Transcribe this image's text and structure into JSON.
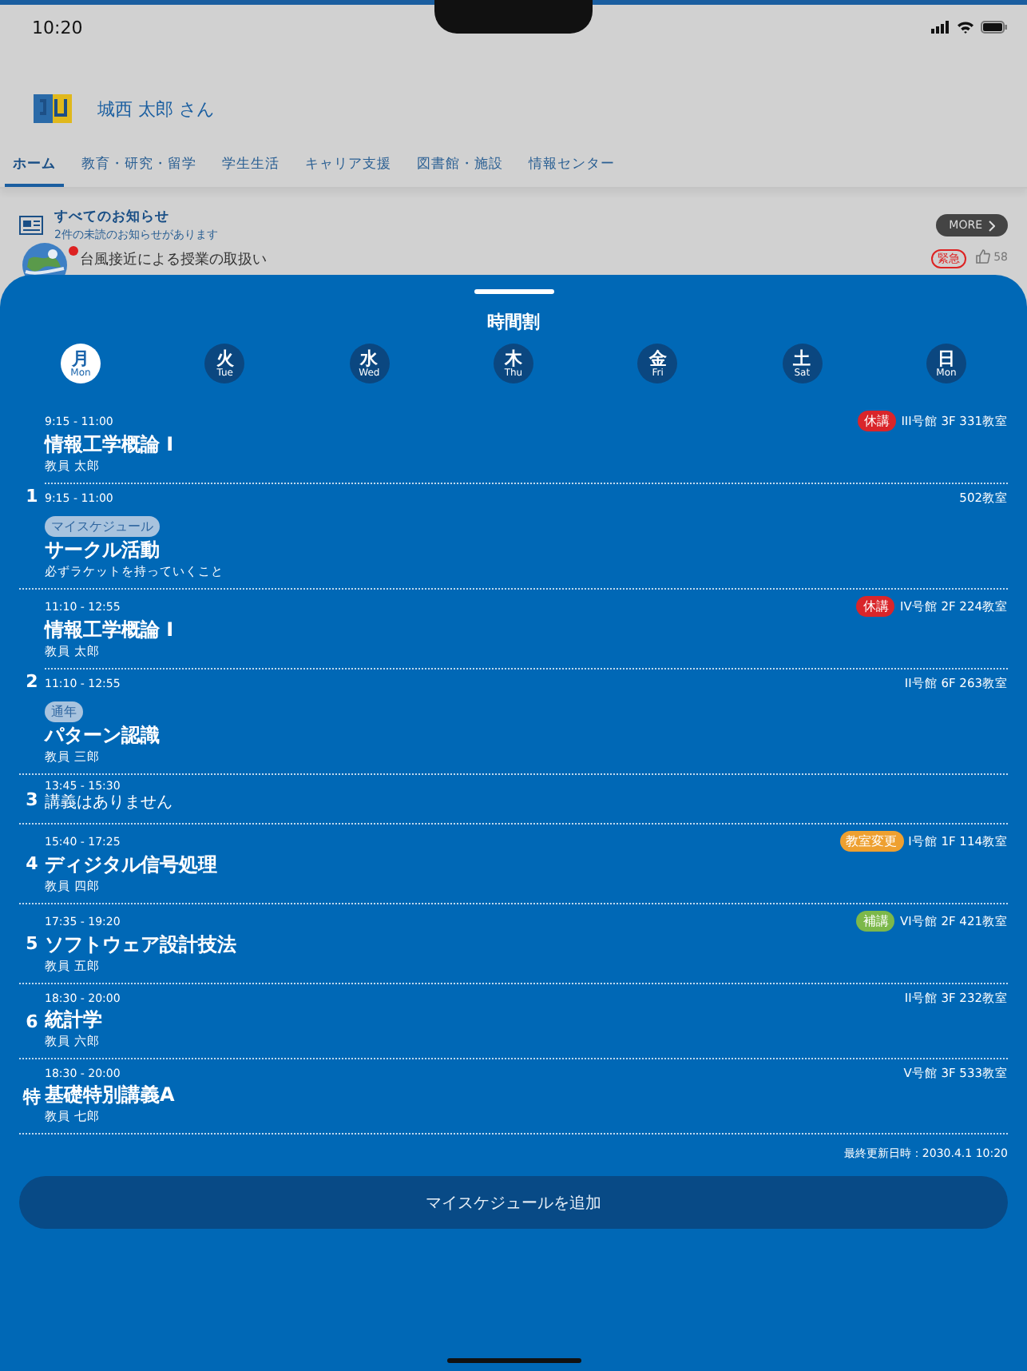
{
  "status_bar": {
    "time": "10:20"
  },
  "header": {
    "user_name": "城西 太郎 さん"
  },
  "nav_tabs": [
    {
      "label": "ホーム",
      "selected": true
    },
    {
      "label": "教育・研究・留学",
      "selected": false
    },
    {
      "label": "学生生活",
      "selected": false
    },
    {
      "label": "キャリア支援",
      "selected": false
    },
    {
      "label": "図書館・施設",
      "selected": false
    },
    {
      "label": "情報センター",
      "selected": false
    }
  ],
  "notices": {
    "title": "すべてのお知らせ",
    "subtitle": "2件の未読のお知らせがあります",
    "more_button": "MORE",
    "items": [
      {
        "title": "台風接近による授業の取扱い",
        "unread": true,
        "tag": "緊急",
        "likes": "58"
      }
    ]
  },
  "timetable": {
    "title": "時間割",
    "days": [
      {
        "label": "月",
        "sub": "Mon",
        "selected": true
      },
      {
        "label": "火",
        "sub": "Tue",
        "selected": false
      },
      {
        "label": "水",
        "sub": "Wed",
        "selected": false
      },
      {
        "label": "木",
        "sub": "Thu",
        "selected": false
      },
      {
        "label": "金",
        "sub": "Fri",
        "selected": false
      },
      {
        "label": "土",
        "sub": "Sat",
        "selected": false
      },
      {
        "label": "日",
        "sub": "Mon",
        "selected": false
      }
    ],
    "periods": [
      {
        "label": "1",
        "classes": [
          {
            "time": "9:15 - 11:00",
            "tag": {
              "text": "休講",
              "kind": "cancelled"
            },
            "room": "III号館 3F 331教室",
            "title": "情報工学概論 I",
            "subtitle": "教員 太郎"
          },
          {
            "time": "9:15 - 11:00",
            "tag": {
              "text": "マイスケジュール",
              "kind": "label"
            },
            "room": "502教室",
            "title": "サークル活動",
            "subtitle": "必ずラケットを持っていくこと"
          }
        ]
      },
      {
        "label": "2",
        "classes": [
          {
            "time": "11:10 - 12:55",
            "tag": {
              "text": "休講",
              "kind": "cancelled"
            },
            "room": "IV号館 2F 224教室",
            "title": "情報工学概論 I",
            "subtitle": "教員 太郎"
          },
          {
            "time": "11:10 - 12:55",
            "tag": {
              "text": "通年",
              "kind": "label"
            },
            "room": "II号館 6F 263教室",
            "title": "パターン認識",
            "subtitle": "教員 三郎"
          }
        ]
      },
      {
        "label": "3",
        "classes": [
          {
            "time": "13:45 - 15:30",
            "title": "講義はありません",
            "kind": "empty"
          }
        ]
      },
      {
        "label": "4",
        "classes": [
          {
            "time": "15:40 - 17:25",
            "tag": {
              "text": "教室変更",
              "kind": "room_change"
            },
            "room": "I号館 1F 114教室",
            "title": "ディジタル信号処理",
            "subtitle": "教員 四郎"
          }
        ]
      },
      {
        "label": "5",
        "classes": [
          {
            "time": "17:35 - 19:20",
            "tag": {
              "text": "補講",
              "kind": "makeup"
            },
            "room": "VI号館 2F 421教室",
            "title": "ソフトウェア設計技法",
            "subtitle": "教員 五郎"
          }
        ]
      },
      {
        "label": "6",
        "classes": [
          {
            "time": "18:30 - 20:00",
            "room": "II号館 3F 232教室",
            "title": "統計学",
            "subtitle": "教員 六郎"
          }
        ]
      },
      {
        "label": "特",
        "classes": [
          {
            "time": "18:30 - 20:00",
            "room": "V号館 3F 533教室",
            "title": "基礎特別講義A",
            "subtitle": "教員 七郎"
          }
        ]
      }
    ],
    "updated": "最終更新日時：2030.4.1 10:20",
    "add_button": "マイスケジュールを追加"
  }
}
